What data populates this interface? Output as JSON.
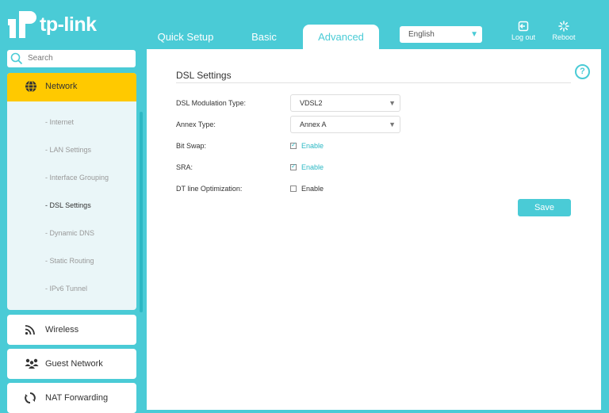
{
  "header": {
    "logo_text": "tp-link",
    "tabs": [
      {
        "label": "Quick Setup"
      },
      {
        "label": "Basic"
      },
      {
        "label": "Advanced"
      }
    ],
    "language": {
      "selected": "English"
    },
    "logout_label": "Log out",
    "reboot_label": "Reboot",
    "accent_color": "#4acbd6"
  },
  "sidebar": {
    "search": {
      "placeholder": "Search"
    },
    "network": {
      "label": "Network",
      "items": [
        {
          "label": "- Internet"
        },
        {
          "label": "- LAN Settings"
        },
        {
          "label": "- Interface Grouping"
        },
        {
          "label": "- DSL Settings"
        },
        {
          "label": "- Dynamic DNS"
        },
        {
          "label": "- Static Routing"
        },
        {
          "label": "- IPv6 Tunnel"
        }
      ],
      "active_item": "- DSL Settings",
      "highlight_color": "#ffc900"
    },
    "menu": [
      {
        "label": "Wireless",
        "icon": "wireless-icon"
      },
      {
        "label": "Guest Network",
        "icon": "guest-network-icon"
      },
      {
        "label": "NAT Forwarding",
        "icon": "nat-forwarding-icon"
      }
    ]
  },
  "main": {
    "title": "DSL Settings",
    "fields": {
      "modulation": {
        "label": "DSL Modulation Type:",
        "value": "VDSL2"
      },
      "annex": {
        "label": "Annex Type:",
        "value": "Annex A"
      },
      "bitswap": {
        "label": "Bit Swap:",
        "option": "Enable",
        "checked": true
      },
      "sra": {
        "label": "SRA:",
        "option": "Enable",
        "checked": true
      },
      "dtline": {
        "label": "DT line Optimization:",
        "option": "Enable",
        "checked": false
      }
    },
    "save_label": "Save"
  }
}
